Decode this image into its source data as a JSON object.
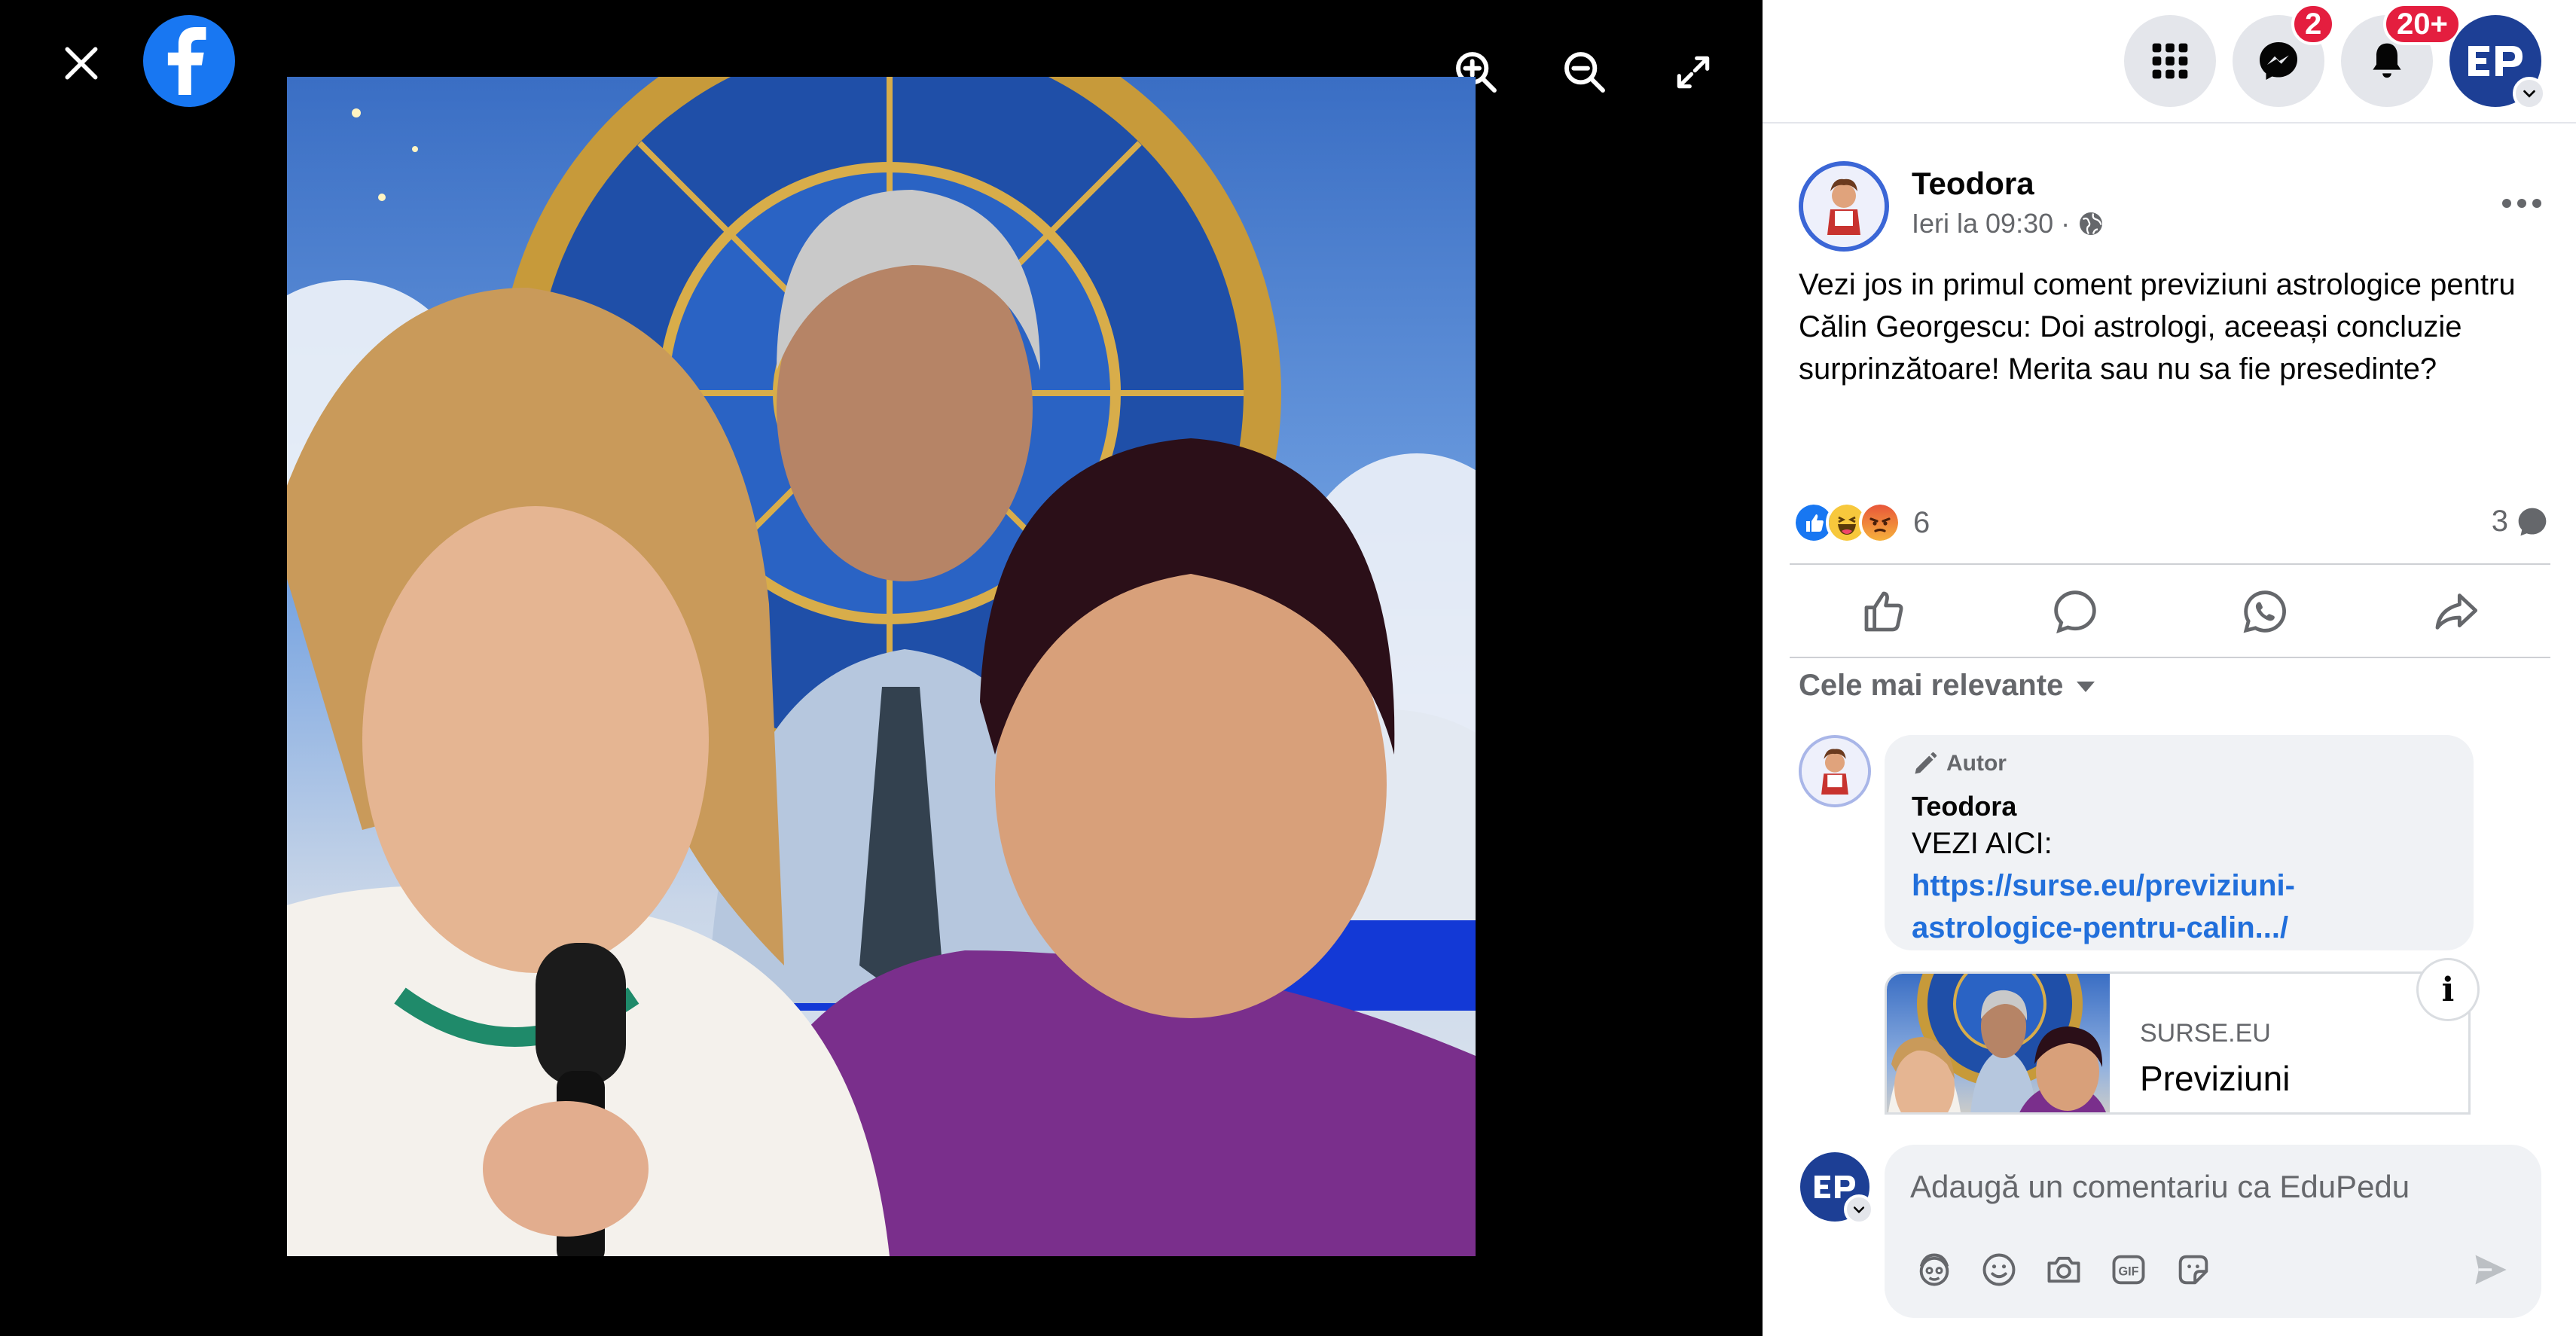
{
  "viewer": {
    "icons": {
      "close": "close-icon",
      "logo": "facebook-logo",
      "zoom_in": "zoom-in-icon",
      "zoom_out": "zoom-out-icon",
      "fullscreen": "fullscreen-icon"
    }
  },
  "topbar": {
    "menu_icon": "grid-menu-icon",
    "messenger_badge": "2",
    "notifications_badge": "20+",
    "account_initials": "EP"
  },
  "post": {
    "author": "Teodora",
    "timestamp": "Ieri la 09:30",
    "separator": "·",
    "audience_icon": "globe-icon",
    "text": "Vezi jos in primul coment previziuni astrologice pentru Călin Georgescu: Doi astrologi, aceeași concluzie surprinzătoare! Merita sau nu sa fie presedinte?",
    "reactions_count": "6",
    "comments_count": "3",
    "reaction_types": [
      "like",
      "haha",
      "angry"
    ]
  },
  "actions": {
    "like": "like-icon",
    "comment": "comment-icon",
    "whatsapp": "whatsapp-icon",
    "share": "share-icon"
  },
  "comments": {
    "sort_label": "Cele mai relevante",
    "first": {
      "badge": "Autor",
      "author": "Teodora",
      "text": "VEZI AICI:",
      "link": "https://surse.eu/previziuni-astrologice-pentru-calin.../"
    }
  },
  "link_preview": {
    "domain": "SURSE.EU",
    "title": "Previziuni"
  },
  "composer": {
    "placeholder": "Adaugă un comentariu ca EduPedu",
    "tools": [
      "avatar-sticker-icon",
      "emoji-icon",
      "camera-icon",
      "gif-icon",
      "sticker-icon"
    ],
    "send": "send-icon"
  },
  "colors": {
    "brand": "#1877F2",
    "badge": "#e41e3f",
    "link": "#216fdb",
    "account": "#1d3f95"
  }
}
